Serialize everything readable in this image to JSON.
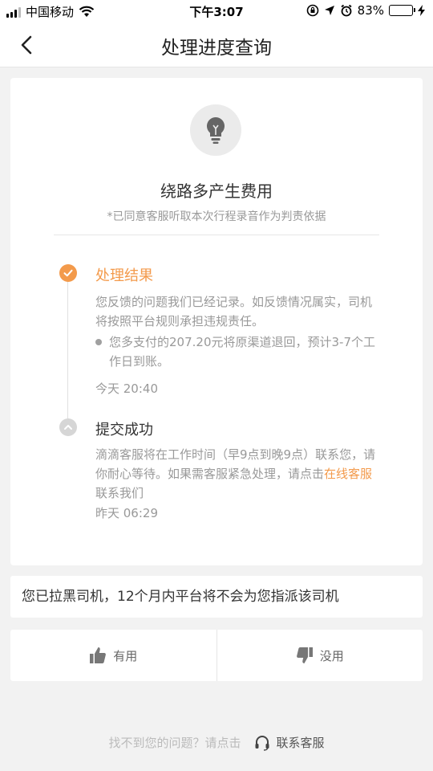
{
  "status_bar": {
    "carrier": "中国移动",
    "time": "下午3:07",
    "battery": "83%",
    "battery_level": 0.83
  },
  "nav": {
    "title": "处理进度查询"
  },
  "card": {
    "icon": "lightbulb-icon",
    "title": "绕路多产生费用",
    "subtitle": "*已同意客服听取本次行程录音作为判责依据"
  },
  "timeline": {
    "result": {
      "title": "处理结果",
      "text": "您反馈的问题我们已经记录。如反馈情况属实，司机将按照平台规则承担违规责任。",
      "bullet": "您多支付的207.20元将原渠道退回，预计3-7个工作日到账。",
      "time": "今天 20:40"
    },
    "submit": {
      "title": "提交成功",
      "text_before": "滴滴客服将在工作时间（早9点到晚9点）联系您，请你耐心等待。如果需客服紧急处理，请点击",
      "link": "在线客服",
      "text_after": "联系我们",
      "time": "昨天 06:29"
    }
  },
  "notice": {
    "text": "您已拉黑司机，12个月内平台将不会为您指派该司机"
  },
  "feedback": {
    "useful": "有用",
    "useless": "没用"
  },
  "footer": {
    "prompt": "找不到您的问题？请点击",
    "contact": "联系客服"
  },
  "colors": {
    "accent": "#f39a4b",
    "background": "#f2f2f2",
    "battery_green": "#4cd964"
  }
}
